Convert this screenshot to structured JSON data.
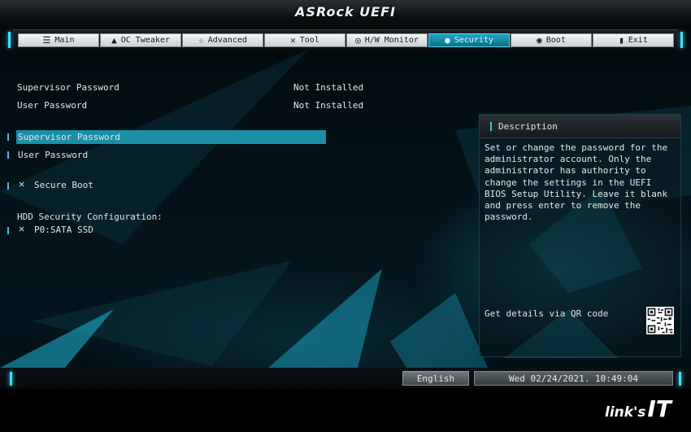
{
  "header": {
    "brand": "ASRock UEFI"
  },
  "tabs": [
    {
      "label": "Main",
      "icon": "list-icon",
      "glyph": "☰"
    },
    {
      "label": "OC Tweaker",
      "icon": "rocket-icon",
      "glyph": "🚀"
    },
    {
      "label": "Advanced",
      "icon": "star-icon",
      "glyph": "☆"
    },
    {
      "label": "Tool",
      "icon": "tools-icon",
      "glyph": "✕"
    },
    {
      "label": "H/W Monitor",
      "icon": "monitor-icon",
      "glyph": "◎"
    },
    {
      "label": "Security",
      "icon": "shield-icon",
      "glyph": "⛨"
    },
    {
      "label": "Boot",
      "icon": "power-icon",
      "glyph": "⏻"
    },
    {
      "label": "Exit",
      "icon": "exit-icon",
      "glyph": "⇥"
    }
  ],
  "active_tab": "Security",
  "status": {
    "supervisor_label": "Supervisor Password",
    "supervisor_value": "Not Installed",
    "user_label": "User Password",
    "user_value": "Not Installed"
  },
  "items": {
    "supervisor_password": "Supervisor Password",
    "user_password": "User Password",
    "secure_boot": "Secure Boot",
    "hdd_section": "HDD Security Configuration:",
    "hdd_device": "P0:SATA SSD"
  },
  "description": {
    "title": "Description",
    "text": "Set or change the password for the administrator account. Only the administrator has authority to change the settings in the UEFI BIOS Setup Utility. Leave it blank and press enter to remove the password.",
    "qr_label": "Get details via QR code"
  },
  "bottom": {
    "language": "English",
    "datetime": "Wed 02/24/2021. 10:49:04"
  },
  "watermark": {
    "part1": "link's",
    "part2": "IT"
  },
  "colors": {
    "accent": "#37c6e6",
    "selection": "#1c8fa6"
  }
}
